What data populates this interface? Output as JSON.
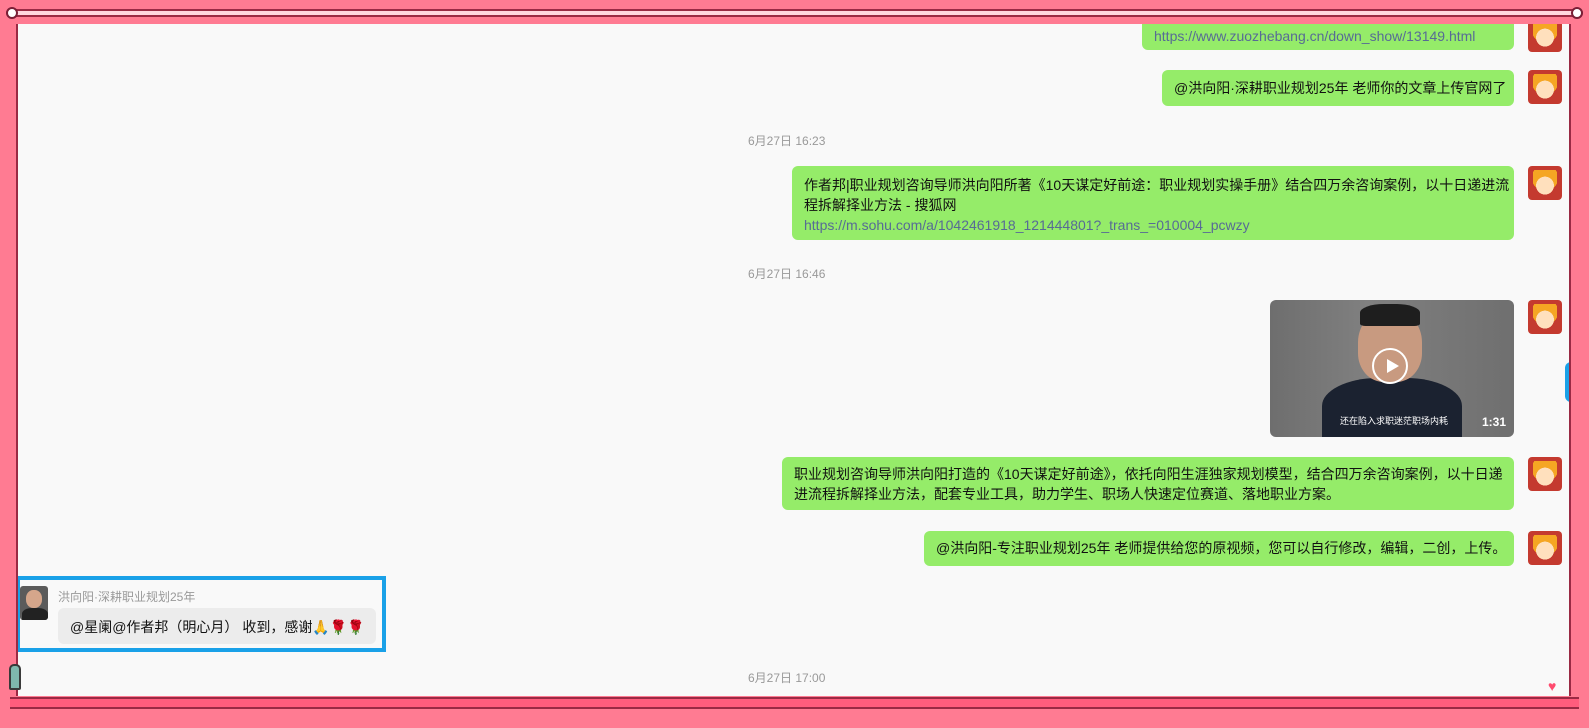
{
  "messages": {
    "m1_link": "https://www.zuozhebang.cn/down_show/13149.html",
    "m2_text": "@洪向阳·深耕职业规划25年 老师你的文章上传官网了",
    "ts1": "6月27日 16:23",
    "m3_line1": "作者邦|职业规划咨询导师洪向阳所著《10天谋定好前途：职业规划实操手册》结合四万余咨询案例，以十日递进流",
    "m3_line2": "程拆解择业方法 - 搜狐网",
    "m3_link": "https://m.sohu.com/a/1042461918_121444801?_trans_=010004_pcwzy",
    "ts2": "6月27日 16:46",
    "video_caption": "还在陷入求职迷茫职场内耗",
    "video_duration": "1:31",
    "m5_line1": "职业规划咨询导师洪向阳打造的《10天谋定好前途》，依托向阳生涯独家规划模型，结合四万余咨询案例，以十日递",
    "m5_line2": "进流程拆解择业方法，配套专业工具，助力学生、职场人快速定位赛道、落地职业方案。",
    "m6_text": "@洪向阳-专注职业规划25年 老师提供给您的原视频，您可以自行修改，编辑，二创，上传。",
    "received_sender": "洪向阳·深耕职业规划25年",
    "received_text": "@星阑@作者邦（明心月） 收到，感谢🙏🌹🌹",
    "ts3": "6月27日 17:00"
  },
  "colors": {
    "frame": "#ff7b92",
    "sent_bubble": "#95ec69",
    "link": "#576b95",
    "highlight": "#1aa1e8"
  }
}
